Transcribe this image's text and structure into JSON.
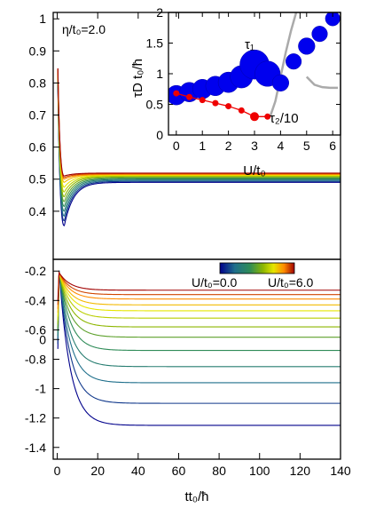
{
  "chart_data": [
    {
      "panel": "top",
      "type": "line",
      "annotation": "η/t₀=2.0",
      "xlabel": "tt₀/ħ",
      "ylabel": "",
      "xlim": [
        -2,
        140
      ],
      "ylim": [
        0.25,
        1.02
      ],
      "yticks": [
        0,
        0.4,
        0.5,
        0.6,
        0.7,
        0.8,
        0.9,
        1
      ],
      "ytick_labels": [
        "0",
        "0.4",
        "0.5",
        "0.6",
        "0.7",
        "0.8",
        "0.9",
        "1"
      ],
      "grid": false,
      "colormap": [
        "#00008b",
        "#1f6f8b",
        "#2e8b57",
        "#8db600",
        "#e6e600",
        "#ff8c00",
        "#a00000"
      ],
      "curve_params_comment_excluded": true,
      "series": [
        {
          "U": 0.0,
          "start": 1.0,
          "dip": 0.355,
          "final": 0.49
        },
        {
          "U": 0.5,
          "start": 1.0,
          "dip": 0.37,
          "final": 0.493
        },
        {
          "U": 1.0,
          "start": 1.0,
          "dip": 0.385,
          "final": 0.496
        },
        {
          "U": 1.5,
          "start": 1.0,
          "dip": 0.4,
          "final": 0.499
        },
        {
          "U": 2.0,
          "start": 1.0,
          "dip": 0.415,
          "final": 0.502
        },
        {
          "U": 2.5,
          "start": 1.0,
          "dip": 0.43,
          "final": 0.505
        },
        {
          "U": 3.0,
          "start": 1.0,
          "dip": 0.445,
          "final": 0.508
        },
        {
          "U": 3.5,
          "start": 1.0,
          "dip": 0.46,
          "final": 0.51
        },
        {
          "U": 4.0,
          "start": 1.0,
          "dip": 0.475,
          "final": 0.512
        },
        {
          "U": 4.5,
          "start": 1.0,
          "dip": 0.49,
          "final": 0.514
        },
        {
          "U": 5.0,
          "start": 1.0,
          "dip": 0.5,
          "final": 0.515
        },
        {
          "U": 5.5,
          "start": 1.0,
          "dip": 0.505,
          "final": 0.517
        },
        {
          "U": 6.0,
          "start": 1.0,
          "dip": 0.51,
          "final": 0.519
        }
      ]
    },
    {
      "panel": "inset",
      "type": "scatter",
      "xlabel": "U/t₀",
      "ylabel": "τD t₀/ħ",
      "xlim": [
        -0.3,
        6.3
      ],
      "ylim": [
        0,
        2
      ],
      "xticks": [
        0,
        1,
        2,
        3,
        4,
        5,
        6
      ],
      "yticks": [
        0,
        0.5,
        1,
        1.5,
        2
      ],
      "ytick_labels": [
        "0",
        "0.5",
        "1",
        "1.5",
        "2"
      ],
      "labels": {
        "tau1": "τ₁",
        "tau2": "τ₂/10"
      },
      "tau1": {
        "x": [
          0,
          0.5,
          1,
          1.5,
          2,
          2.5,
          3,
          3.5,
          4,
          4.5,
          5,
          5.5,
          6
        ],
        "y": [
          0.65,
          0.7,
          0.75,
          0.8,
          0.86,
          0.95,
          1.15,
          1.0,
          0.85,
          1.2,
          1.45,
          1.65,
          1.9
        ],
        "marker_scale": [
          1.0,
          1.0,
          1.0,
          1.0,
          1.05,
          1.15,
          1.5,
          1.3,
          0.85,
          0.8,
          0.85,
          0.8,
          0.75
        ],
        "color": "#0000ee"
      },
      "tau2": {
        "x": [
          0,
          0.5,
          1,
          1.5,
          2,
          2.5,
          3,
          3.5
        ],
        "y": [
          0.68,
          0.62,
          0.57,
          0.52,
          0.47,
          0.4,
          0.3,
          0.3
        ],
        "color": "#ee0000"
      },
      "gray_curves": [
        {
          "x": [
            3.6,
            3.8,
            4.0,
            4.2,
            4.4,
            4.6
          ],
          "y": [
            0.3,
            0.55,
            0.95,
            1.35,
            1.7,
            2.0
          ]
        },
        {
          "x": [
            5.0,
            5.3,
            5.6,
            5.9,
            6.2
          ],
          "y": [
            0.95,
            0.82,
            0.78,
            0.77,
            0.77
          ]
        }
      ],
      "gray_color": "#aaaaaa"
    },
    {
      "panel": "bottom",
      "type": "line",
      "xlabel": "tt₀/ħ",
      "ylabel": "",
      "xlim": [
        -2,
        140
      ],
      "ylim": [
        -1.48,
        -0.12
      ],
      "xticks": [
        0,
        20,
        40,
        60,
        80,
        100,
        120,
        140
      ],
      "yticks": [
        -0.2,
        -0.4,
        -0.6,
        -0.8,
        -1,
        -1.2,
        -1.4
      ],
      "ytick_labels": [
        "-0.2",
        "-0.4",
        "-0.6",
        "-0.8",
        "-1",
        "-1.2",
        "-1.4"
      ],
      "grid": false,
      "legend": {
        "left": "U/t₀=0.0",
        "right": "U/t₀=6.0",
        "placement": "top-right"
      },
      "series": [
        {
          "U": 0.0,
          "start": -1.0,
          "peak": -0.19,
          "final": -1.25
        },
        {
          "U": 0.5,
          "start": -0.95,
          "peak": -0.19,
          "final": -1.1
        },
        {
          "U": 1.0,
          "start": -0.9,
          "peak": -0.2,
          "final": -0.96
        },
        {
          "U": 1.5,
          "start": -0.86,
          "peak": -0.2,
          "final": -0.85
        },
        {
          "U": 2.0,
          "start": -0.82,
          "peak": -0.2,
          "final": -0.74
        },
        {
          "U": 2.5,
          "start": -0.78,
          "peak": -0.21,
          "final": -0.65
        },
        {
          "U": 3.0,
          "start": -0.74,
          "peak": -0.21,
          "final": -0.58
        },
        {
          "U": 3.5,
          "start": -0.7,
          "peak": -0.21,
          "final": -0.52
        },
        {
          "U": 4.0,
          "start": -0.66,
          "peak": -0.21,
          "final": -0.47
        },
        {
          "U": 4.5,
          "start": -0.62,
          "peak": -0.21,
          "final": -0.43
        },
        {
          "U": 5.0,
          "start": -0.58,
          "peak": -0.21,
          "final": -0.39
        },
        {
          "U": 5.5,
          "start": -0.54,
          "peak": -0.21,
          "final": -0.36
        },
        {
          "U": 6.0,
          "start": -0.5,
          "peak": -0.21,
          "final": -0.33
        }
      ]
    }
  ]
}
